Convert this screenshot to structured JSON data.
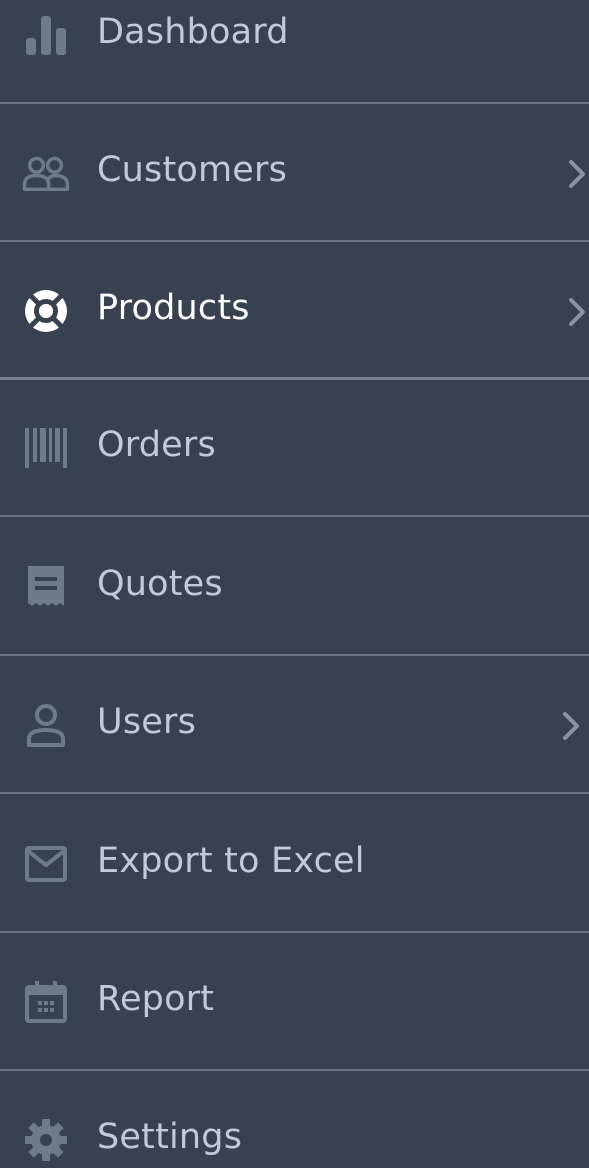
{
  "sidebar": {
    "items": [
      {
        "label": "Dashboard",
        "icon": "bar-chart-icon",
        "has_submenu": false
      },
      {
        "label": "Customers",
        "icon": "users-icon",
        "has_submenu": true
      },
      {
        "label": "Products",
        "icon": "lifebuoy-icon",
        "has_submenu": true,
        "active": true
      },
      {
        "label": "Orders",
        "icon": "barcode-icon",
        "has_submenu": false
      },
      {
        "label": "Quotes",
        "icon": "receipt-icon",
        "has_submenu": false
      },
      {
        "label": "Users",
        "icon": "user-icon",
        "has_submenu": true
      },
      {
        "label": "Export to Excel",
        "icon": "envelope-icon",
        "has_submenu": false
      },
      {
        "label": "Report",
        "icon": "calendar-icon",
        "has_submenu": false
      },
      {
        "label": "Settings",
        "icon": "gear-icon",
        "has_submenu": false
      }
    ]
  },
  "colors": {
    "background": "#374150",
    "divider": "#6b7280",
    "text": "#c3cad6",
    "active_text": "#ffffff",
    "icon": "#6f7a89"
  }
}
